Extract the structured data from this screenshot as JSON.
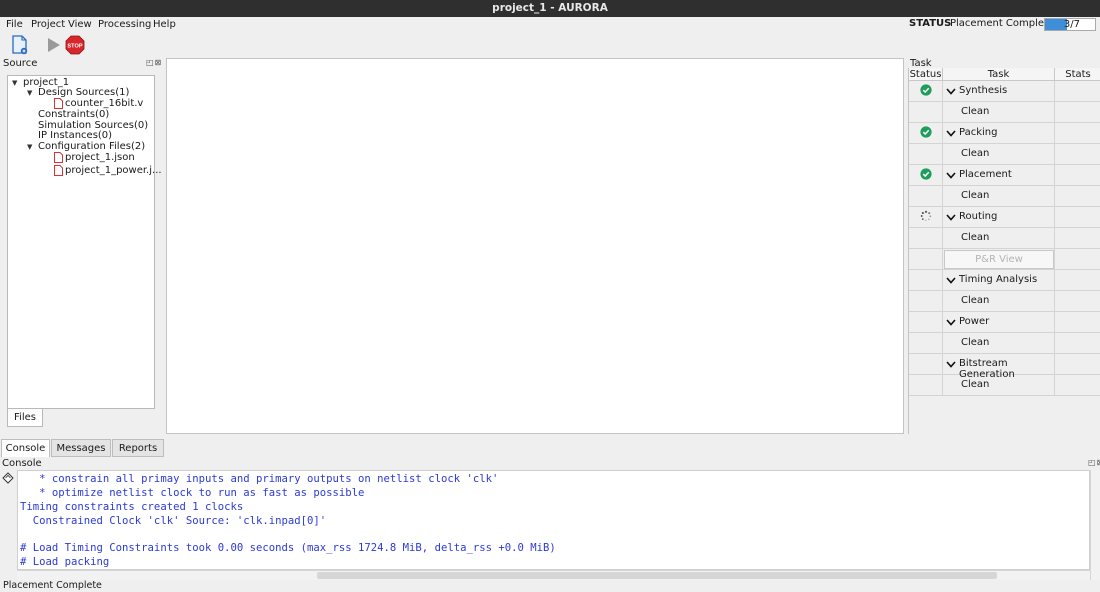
{
  "window": {
    "title": "project_1 - AURORA"
  },
  "menu": {
    "items": [
      "File",
      "Project",
      "View",
      "Processing",
      "Help"
    ]
  },
  "status": {
    "label": "STATUS",
    "text": "Placement Complete",
    "progress_text": "3/7",
    "progress_fraction": 0.43
  },
  "toolbar": {
    "icons": [
      "new-project-icon",
      "run-icon",
      "stop-icon"
    ],
    "stop_text": "STOP"
  },
  "source_panel": {
    "title": "Source",
    "tree": {
      "root": "project_1",
      "design_sources": "Design Sources(1)",
      "design_file": "counter_16bit.v",
      "constraints": "Constraints(0)",
      "simulation_sources": "Simulation Sources(0)",
      "ip_instances": "IP Instances(0)",
      "configuration_files": "Configuration Files(2)",
      "config_file_1": "project_1.json",
      "config_file_2": "project_1_power.j..."
    },
    "tab": "Files"
  },
  "task_panel": {
    "title": "Task",
    "columns": {
      "status": "Status",
      "task": "Task",
      "stats": "Stats"
    },
    "tasks": [
      {
        "name": "Synthesis",
        "status": "done",
        "sub": "Clean"
      },
      {
        "name": "Packing",
        "status": "done",
        "sub": "Clean"
      },
      {
        "name": "Placement",
        "status": "done",
        "sub": "Clean"
      },
      {
        "name": "Routing",
        "status": "running",
        "sub": "Clean",
        "extra_button": "P&R View"
      },
      {
        "name": "Timing Analysis",
        "status": "",
        "sub": "Clean"
      },
      {
        "name": "Power",
        "status": "",
        "sub": "Clean"
      },
      {
        "name": "Bitstream Generation",
        "status": "",
        "sub": "Clean"
      }
    ]
  },
  "bottom_tabs": [
    "Console",
    "Messages",
    "Reports"
  ],
  "console": {
    "title": "Console",
    "lines": [
      "   * constrain all primay inputs and primary outputs on netlist clock 'clk'",
      "   * optimize netlist clock to run as fast as possible",
      "Timing constraints created 1 clocks",
      "  Constrained Clock 'clk' Source: 'clk.inpad[0]'",
      "",
      "# Load Timing Constraints took 0.00 seconds (max_rss 1724.8 MiB, delta_rss +0.0 MiB)",
      "# Load packing"
    ]
  },
  "statusbar": {
    "text": "Placement Complete"
  },
  "colors": {
    "title_bg": "#2f2f2f",
    "console_text": "#2c3ad8",
    "ok_green": "#1e9e5a",
    "progress_blue": "#3f8ed8",
    "stop_red": "#d8262c"
  }
}
